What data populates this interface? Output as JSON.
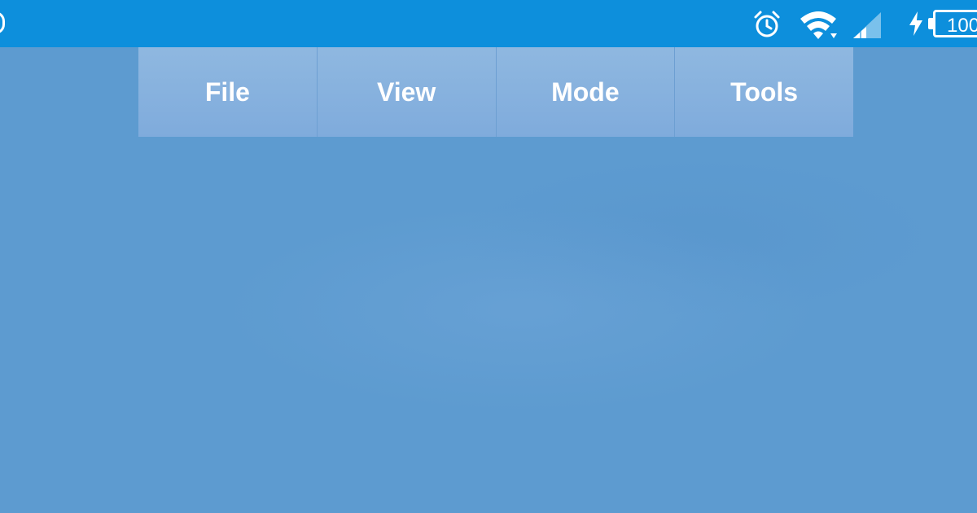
{
  "status_bar": {
    "background_color": "#0d8fdc",
    "icons": [
      "alarm-icon",
      "wifi-icon",
      "signal-icon",
      "charging-icon",
      "battery-icon"
    ],
    "battery_level": "100"
  },
  "menu": {
    "items": [
      {
        "label": "File"
      },
      {
        "label": "View"
      },
      {
        "label": "Mode"
      },
      {
        "label": "Tools"
      }
    ]
  },
  "colors": {
    "wallpaper": "#5d9bd0",
    "menu_item": "#86b1de",
    "text": "#ffffff"
  }
}
